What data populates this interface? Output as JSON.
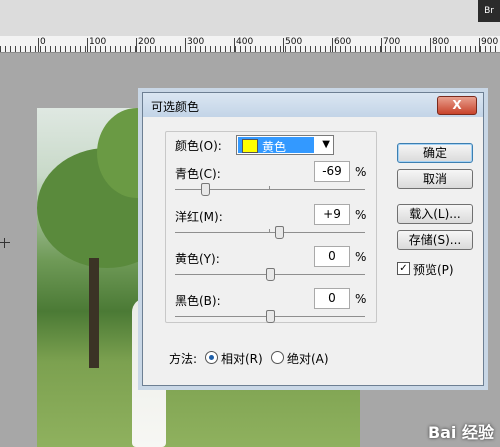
{
  "ps_corner": "Br",
  "ruler": {
    "labels": [
      "0",
      "100",
      "200",
      "300",
      "400",
      "500",
      "600",
      "700",
      "800",
      "900"
    ]
  },
  "dialog": {
    "title": "可选颜色",
    "close": "X",
    "colors_label": "颜色(O):",
    "colors_selected": "黄色",
    "rows": [
      {
        "label": "青色(C):",
        "value": "-69",
        "unit": "%"
      },
      {
        "label": "洋红(M):",
        "value": "+9",
        "unit": "%"
      },
      {
        "label": "黄色(Y):",
        "value": "0",
        "unit": "%"
      },
      {
        "label": "黑色(B):",
        "value": "0",
        "unit": "%"
      }
    ],
    "method_label": "方法:",
    "method_relative": "相对(R)",
    "method_absolute": "绝对(A)",
    "btn_ok": "确定",
    "btn_cancel": "取消",
    "btn_load": "载入(L)...",
    "btn_save": "存储(S)...",
    "preview_label": "预览(P)",
    "preview_checked": true
  },
  "watermark": "Bai 经验"
}
